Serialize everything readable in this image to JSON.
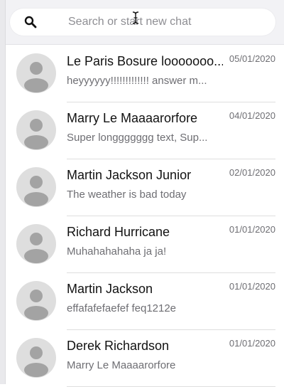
{
  "search": {
    "placeholder": "Search or start new chat",
    "icon": "search-icon"
  },
  "chats": [
    {
      "name": "Le Paris Bosure looooooo...",
      "preview": "heyyyyyy!!!!!!!!!!!!! answer m...",
      "date": "05/01/2020",
      "avatar": "default-avatar-icon"
    },
    {
      "name": "Marry Le Maaaarorfore",
      "preview": "Super longgggggg text, Sup...",
      "date": "04/01/2020",
      "avatar": "default-avatar-icon"
    },
    {
      "name": "Martin Jackson Junior",
      "preview": "The weather is bad today",
      "date": "02/01/2020",
      "avatar": "default-avatar-icon"
    },
    {
      "name": "Richard Hurricane",
      "preview": "Muhahahahaha ja ja!",
      "date": "01/01/2020",
      "avatar": "default-avatar-icon"
    },
    {
      "name": "Martin Jackson",
      "preview": "effafafefaefef feq1212e",
      "date": "01/01/2020",
      "avatar": "default-avatar-icon"
    },
    {
      "name": "Derek Richardson",
      "preview": "Marry Le Maaaarorfore",
      "date": "01/01/2020",
      "avatar": "default-avatar-icon"
    }
  ],
  "colors": {
    "background": "#ffffff",
    "search_area": "#f2f2f5",
    "avatar_bg": "#dedede",
    "avatar_fg": "#a3a3a3",
    "name_text": "#111111",
    "secondary_text": "#6e6e73",
    "divider": "#dedede"
  }
}
